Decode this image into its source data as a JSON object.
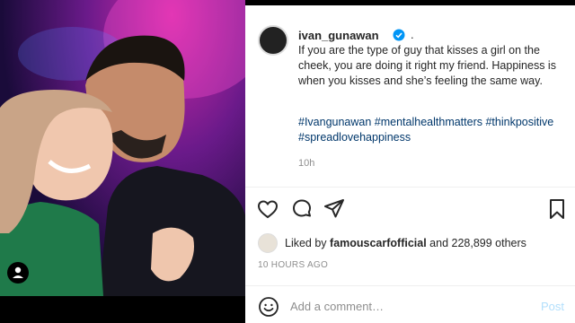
{
  "post": {
    "username": "ivan_gunawan",
    "dot": ".",
    "caption": "If you are the type of guy that kisses a girl on the cheek, you are doing it right my friend. Happiness is when you kisses and she’s feeling the same way.",
    "hashtags": "#Ivangunawan #mentalhealthmatters #thinkpositive #spreadlovehappiness",
    "caption_time": "10h",
    "liked_by_prefix": "Liked by ",
    "liked_by_user": "famouscarfofficial",
    "liked_by_suffix": " and 228,899 others",
    "timestamp": "10 HOURS AGO",
    "comment_placeholder": "Add a comment…",
    "post_button": "Post"
  },
  "icons": {
    "like": "heart-icon",
    "comment": "comment-icon",
    "share": "share-icon",
    "save": "bookmark-icon",
    "emoji": "emoji-icon",
    "user_tag": "user-tag-icon",
    "verified": "verified-badge-icon"
  },
  "colors": {
    "accent_blue": "#0095f6",
    "hashtag_blue": "#00376b",
    "post_button_disabled": "#b2dffc"
  }
}
